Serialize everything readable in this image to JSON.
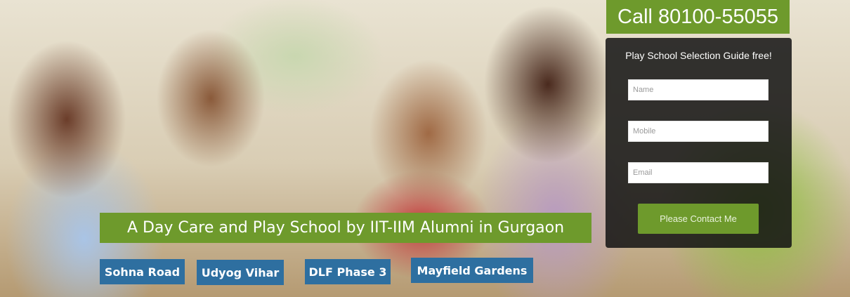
{
  "call": {
    "label": "Call 80100-55055"
  },
  "form": {
    "title": "Play School Selection Guide free!",
    "name_placeholder": "Name",
    "mobile_placeholder": "Mobile",
    "email_placeholder": "Email",
    "submit_label": "Please Contact Me"
  },
  "headline": "A Day Care and Play School by IIT-IIM Alumni in Gurgaon",
  "locations": [
    "Sohna Road",
    "Udyog Vihar",
    "DLF Phase 3",
    "Mayfield Gardens"
  ],
  "colors": {
    "green": "#6e9a2c",
    "blue": "#2e6fa0",
    "panel": "#141414"
  }
}
